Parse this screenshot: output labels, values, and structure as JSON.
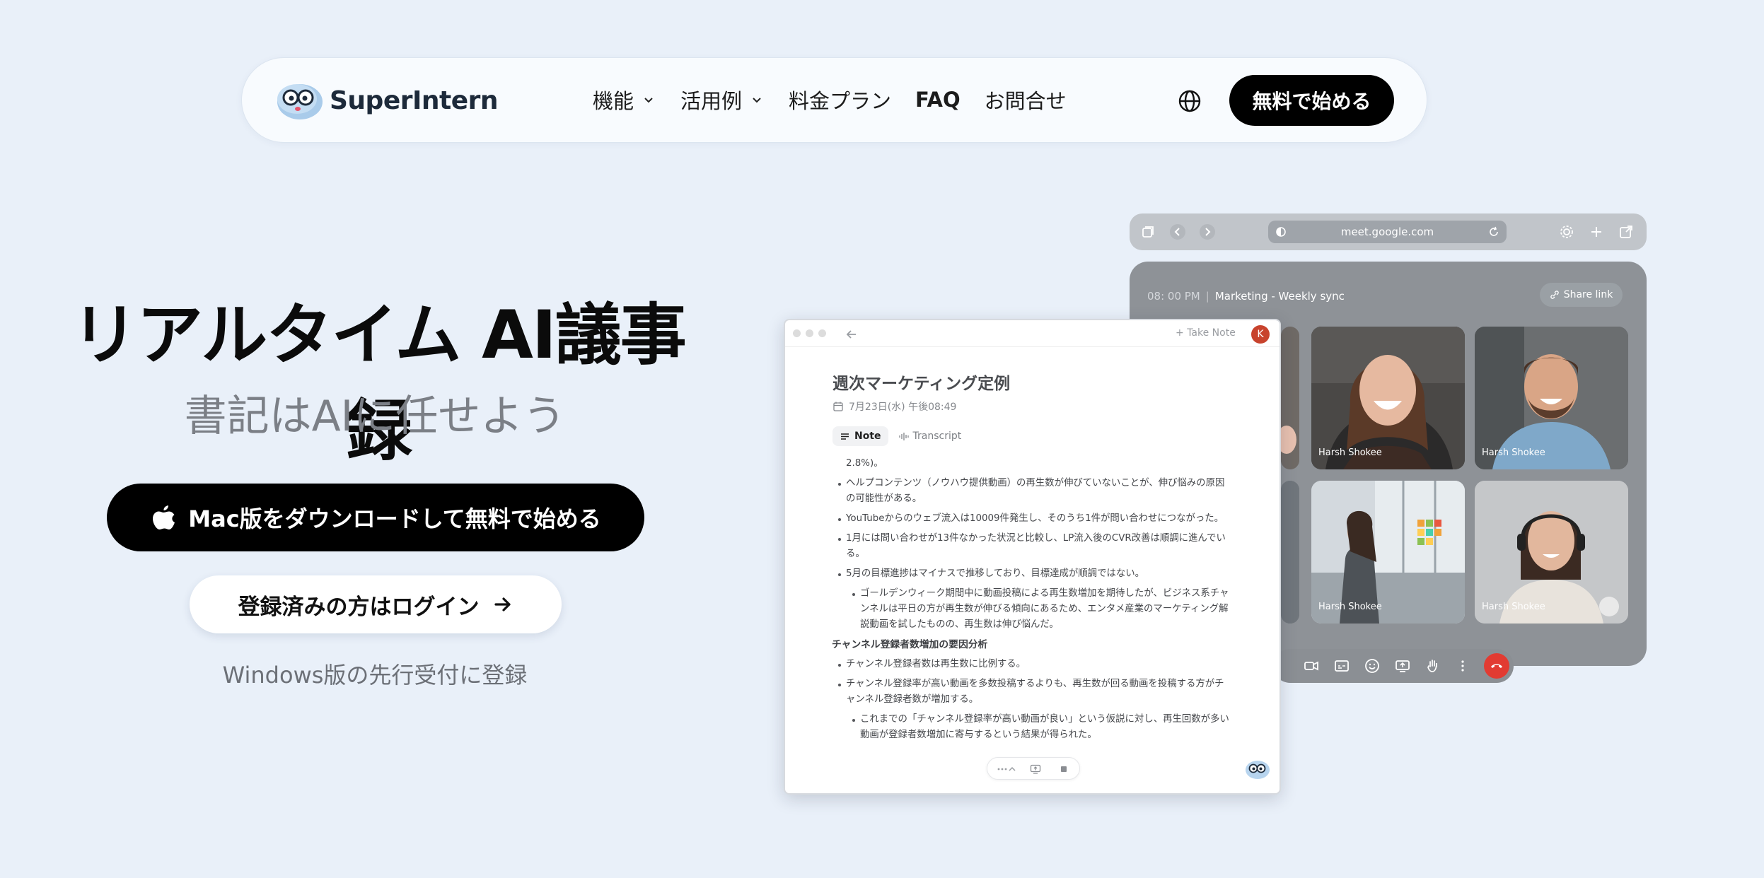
{
  "nav": {
    "brand": "SuperIntern",
    "menu": [
      "機能",
      "活用例",
      "料金プラン",
      "FAQ",
      "お問合せ"
    ],
    "cta": "無料で始める"
  },
  "hero": {
    "title": "リアルタイム AI議事録",
    "subtitle": "書記はAIに任せよう",
    "mac_button": "Mac版をダウンロードして無料で始める",
    "login_button": "登録済みの方はログイン",
    "windows_link": "Windows版の先行受付に登録"
  },
  "browser": {
    "url": "meet.google.com"
  },
  "meet": {
    "time": "08: 00 PM",
    "separator": "|",
    "title": "Marketing - Weekly sync",
    "share": "Share link",
    "participants": [
      "Harsh Shokee",
      "Harsh Shokee",
      "Harsh Shokee",
      "Harsh Shokee"
    ]
  },
  "note": {
    "take_note": "Take Note",
    "avatar": "K",
    "title": "週次マーケティング定例",
    "date": "7月23日(水) 午後08:49",
    "tabs": [
      "Note",
      "Transcript"
    ],
    "lines": [
      "2.8%)。",
      "ヘルプコンテンツ（ノウハウ提供動画）の再生数が伸びていないことが、伸び悩みの原因",
      "の可能性がある。",
      "YouTubeからのウェブ流入は10009件発生し、そのうち1件が問い合わせにつながった。",
      "1月には問い合わせが13件なかった状況と比較し、LP流入後のCVR改善は順調に進んでい",
      "る。",
      "5月の目標進捗はマイナスで推移しており、目標達成が順調ではない。",
      "ゴールデンウィーク期間中に動画投稿による再生数増加を期待したが、ビジネス系チャ",
      "ンネルは平日の方が再生数が伸びる傾向にあるため、エンタメ産業のマーケティング解",
      "説動画を試したものの、再生数は伸び悩んだ。",
      "チャンネル登録者数増加の要因分析",
      "チャンネル登録者数は再生数に比例する。",
      "チャンネル登録率が高い動画を多数投稿するよりも、再生数が回る動画を投稿する方がチ",
      "ャンネル登録者数が増加する。",
      "これまでの「チャンネル登録率が高い動画が良い」という仮説に対し、再生回数が多い",
      "動画が登録者数増加に寄与するという結果が得られた。"
    ]
  }
}
